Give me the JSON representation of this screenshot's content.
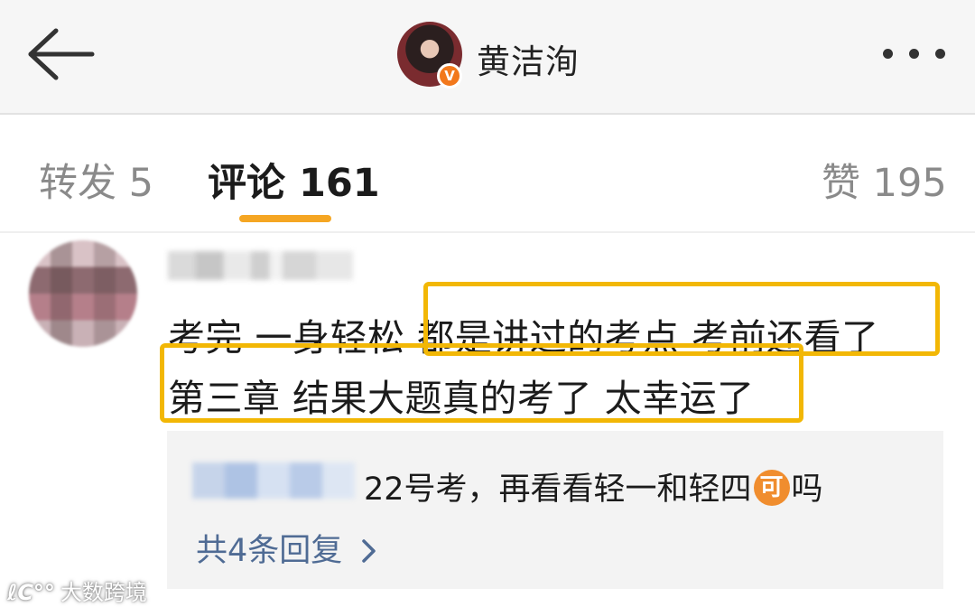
{
  "header": {
    "user_name": "黄洁洵",
    "back_icon": "back-arrow-icon",
    "more_icon": "more-dots-icon",
    "verified_badge": "V",
    "verified_color": "#f2781c"
  },
  "tabs": {
    "repost": "转发 5",
    "comments": "评论 161",
    "likes": "赞 195",
    "active_underline_color": "#f5a623"
  },
  "comment": {
    "line1_plain": "考完 一身轻松 ",
    "line1_highlighted": "都是讲过的考点 考前还看了",
    "line2_highlighted": "第三章 结果大题真的考了 太幸运了",
    "highlight_color": "#f2b705"
  },
  "reply": {
    "text_before_emoji": "22号考，再看看轻一和轻四",
    "emoji_label": "可",
    "text_after_emoji": "吗",
    "view_replies": "共4条回复"
  },
  "watermark": {
    "logo": "ℓC°°",
    "text": "大数跨境"
  }
}
